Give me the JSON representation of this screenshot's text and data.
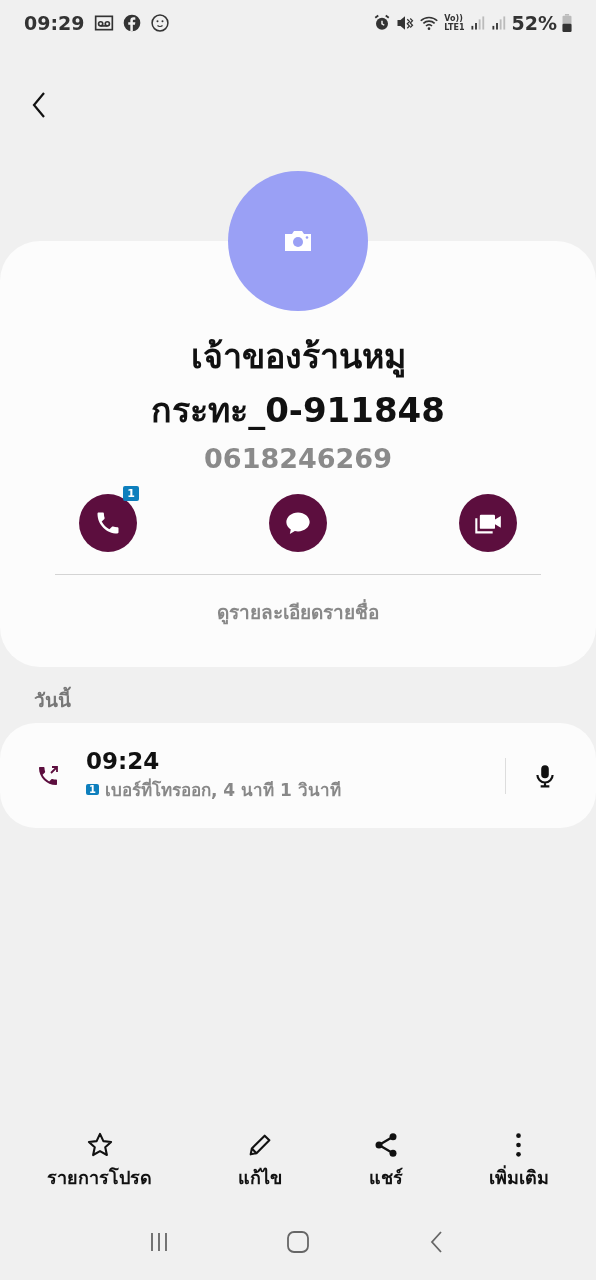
{
  "status_bar": {
    "time": "09:29",
    "volte": "Vo))",
    "lte": "LTE1",
    "battery": "52%"
  },
  "contact": {
    "name_lines": [
      "เจ้าของร้านหมู",
      "กระทะ_0-911848"
    ],
    "phone": "0618246269",
    "actions": [
      {
        "kind": "call",
        "badge": "1"
      },
      {
        "kind": "message"
      },
      {
        "kind": "video"
      }
    ],
    "details_link": "ดูรายละเอียดรายชื่อ"
  },
  "section_title": "วันนี้",
  "call_log": [
    {
      "kind": "outgoing",
      "time": "09:24",
      "sim": "1",
      "description": "เบอร์ที่โทรออก, 4 นาที 1 วินาที"
    }
  ],
  "bottom_actions": [
    {
      "kind": "star",
      "label": "รายการโปรด"
    },
    {
      "kind": "edit",
      "label": "แก้ไข"
    },
    {
      "kind": "share",
      "label": "แชร์"
    },
    {
      "kind": "more",
      "label": "เพิ่มเติม"
    }
  ]
}
